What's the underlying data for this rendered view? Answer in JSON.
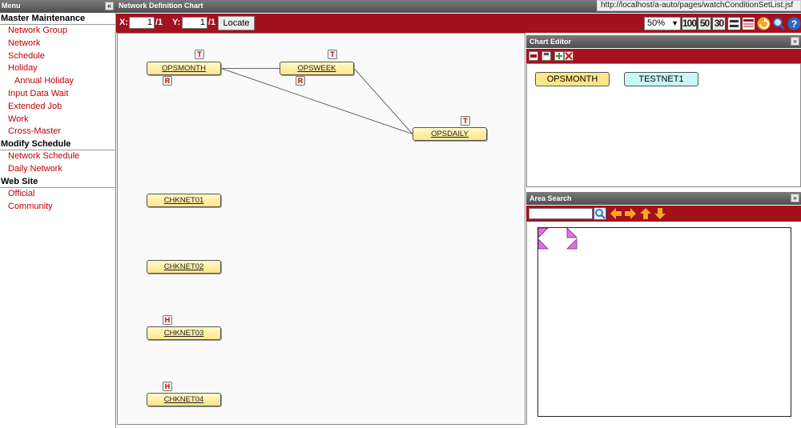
{
  "menu": {
    "title": "Menu",
    "sections": [
      {
        "title": "Master Maintenance",
        "items": [
          "Network Group",
          "Network",
          "Schedule",
          "Holiday",
          "Annual Holiday",
          "Input Data Wait",
          "Extended Job",
          "Work",
          "Cross-Master"
        ]
      },
      {
        "title": "Modify Schedule",
        "items": [
          "Network Schedule",
          "Daily Network"
        ]
      },
      {
        "title": "Web Site",
        "items": [
          "Official",
          "Community"
        ]
      }
    ]
  },
  "window": {
    "title": "Network Definition Chart",
    "url": "http://localhost/a-auto/pages/watchConditionSetList.jsf"
  },
  "toolbar": {
    "x_label": "X:",
    "x_value": "1",
    "x_total": "/1",
    "y_label": "Y:",
    "y_value": "1",
    "y_total": "/1",
    "locate_label": "Locate",
    "zoom_value": "50%",
    "zoom_buttons": [
      "100",
      "50",
      "30"
    ],
    "icons": [
      "grid-layout-icon",
      "table-icon",
      "refresh-icon",
      "magnifier-icon",
      "help-icon"
    ]
  },
  "chart": {
    "nodes": [
      {
        "id": "n1",
        "label": "OPSMONTH",
        "badges": [
          "T",
          "R"
        ]
      },
      {
        "id": "n2",
        "label": "OPSWEEK",
        "badges": [
          "T",
          "R"
        ]
      },
      {
        "id": "n3",
        "label": "OPSDAILY",
        "badges": [
          "T"
        ]
      },
      {
        "id": "n4",
        "label": "CHKNET01",
        "badges": []
      },
      {
        "id": "n5",
        "label": "CHKNET02",
        "badges": []
      },
      {
        "id": "n6",
        "label": "CHKNET03",
        "badges": [
          "H"
        ]
      },
      {
        "id": "n7",
        "label": "CHKNET04",
        "badges": [
          "H"
        ]
      }
    ],
    "edges": [
      [
        "OPSMONTH",
        "OPSWEEK"
      ],
      [
        "OPSMONTH",
        "OPSDAILY"
      ],
      [
        "OPSWEEK",
        "OPSDAILY"
      ]
    ]
  },
  "chart_editor": {
    "title": "Chart Editor",
    "icons": [
      "new-icon",
      "save-icon",
      "add-icon",
      "delete-icon"
    ],
    "items": [
      {
        "label": "OPSMONTH",
        "color": "#ffe58a"
      },
      {
        "label": "TESTNET1",
        "color": "#c8f7f7"
      }
    ]
  },
  "area_search": {
    "title": "Area Search",
    "search_value": "",
    "icons": [
      "search-icon",
      "arrow-left-icon",
      "arrow-right-icon",
      "arrow-up-icon",
      "arrow-down-icon"
    ]
  },
  "colors": {
    "accent": "#a3111c",
    "link": "#c00000",
    "node": "#ffe58a",
    "marker": "#e070e8"
  }
}
